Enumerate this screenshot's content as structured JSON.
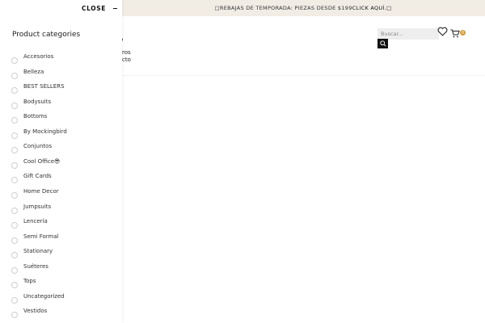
{
  "promo": {
    "text": "□REBAJAS DE TEMPORADA: PIEZAS DESDE $199",
    "link": "CLICK AQUÍ.□"
  },
  "header": {
    "nav_fragments": [
      "o",
      "ros",
      "cto"
    ],
    "search_placeholder": "Buscar...",
    "cart_count": "0",
    "icons": {
      "search": "search-icon",
      "wishlist": "heart-icon",
      "cart": "cart-icon"
    }
  },
  "drawer": {
    "close_label": "CLOSE",
    "title": "Product categories",
    "categories": [
      "Accesorios",
      "Belleza",
      "BEST SELLERS",
      "Bodysuits",
      "Bottoms",
      "By Mockingbird",
      "Conjuntos",
      "Cool Office😎",
      "Gift Cards",
      "Home Decor",
      "Jumpsuits",
      "Lencería",
      "Semi Formal",
      "Stationary",
      "Suéteres",
      "Tops",
      "Uncategorized",
      "Vestidos"
    ]
  },
  "colors": {
    "promo_bg": "#f1ece4",
    "badge": "#d49a3a",
    "dark": "#111111"
  }
}
